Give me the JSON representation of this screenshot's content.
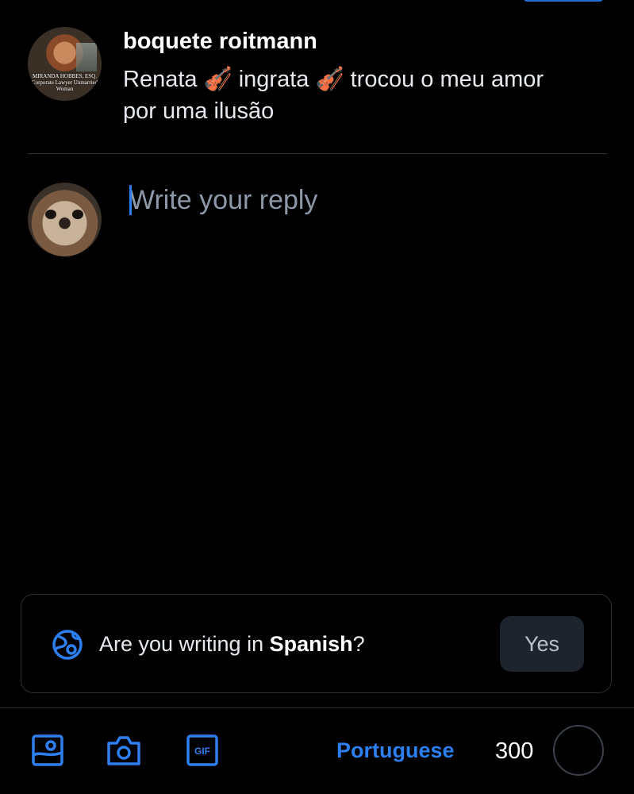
{
  "parent_post": {
    "author": "boquete roitmann",
    "text": "Renata 🎻 ingrata 🎻 trocou o meu amor por uma ilusão",
    "avatar_caption": "MIRANDA HOBBES, ESQ. Corporate Lawyer Unmarried Woman"
  },
  "composer": {
    "placeholder": "Write your reply",
    "value": ""
  },
  "language_suggestion": {
    "question_prefix": "Are you writing in ",
    "language": "Spanish",
    "question_suffix": "?",
    "confirm_label": "Yes"
  },
  "toolbar": {
    "icons": [
      "image-icon",
      "camera-icon",
      "gif-icon"
    ],
    "language": "Portuguese",
    "chars_remaining": "300"
  },
  "colors": {
    "accent": "#2d7ff0",
    "background": "#000000",
    "border": "#2a2f36",
    "muted_text": "#8d99a8"
  }
}
